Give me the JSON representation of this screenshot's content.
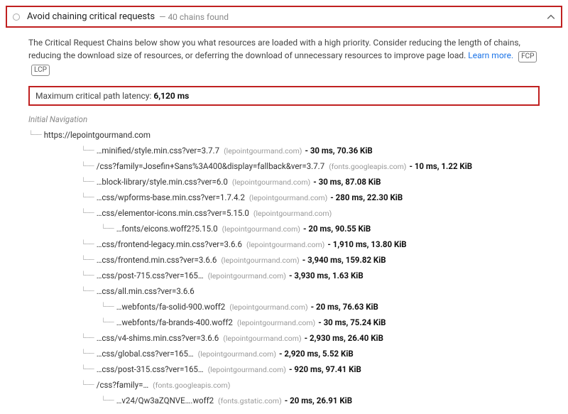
{
  "header": {
    "title": "Avoid chaining critical requests",
    "subtitle": "— 40 chains found"
  },
  "description": {
    "text1": "The Critical Request Chains below show you what resources are loaded with a high priority. Consider reducing the length of chains, reducing the download size of resources, or deferring the download of unnecessary resources to improve page load. ",
    "learn": "Learn more.",
    "badge1": "FCP",
    "badge2": "LCP"
  },
  "latency": {
    "label": "Maximum critical path latency: ",
    "value": "6,120 ms"
  },
  "tree": {
    "initial": "Initial Navigation",
    "root": "https://lepointgourmand.com",
    "rows": [
      {
        "depth": 2,
        "url": "…minified/style.min.css?ver=3.7.7",
        "origin": "(lepointgourmand.com)",
        "metrics": "- 30 ms, 70.36 KiB"
      },
      {
        "depth": 2,
        "url": "/css?family=Josefin+Sans%3A400&display=fallback&ver=3.7.7",
        "origin": "(fonts.googleapis.com)",
        "metrics": "- 10 ms, 1.22 KiB"
      },
      {
        "depth": 2,
        "url": "…block-library/style.min.css?ver=6.0",
        "origin": "(lepointgourmand.com)",
        "metrics": "- 30 ms, 87.08 KiB"
      },
      {
        "depth": 2,
        "url": "…css/wpforms-base.min.css?ver=1.7.4.2",
        "origin": "(lepointgourmand.com)",
        "metrics": "- 280 ms, 22.30 KiB"
      },
      {
        "depth": 2,
        "url": "…css/elementor-icons.min.css?ver=5.15.0",
        "origin": "(lepointgourmand.com)",
        "metrics": ""
      },
      {
        "depth": 3,
        "url": "…fonts/eicons.woff2?5.15.0",
        "origin": "(lepointgourmand.com)",
        "metrics": "- 20 ms, 90.55 KiB"
      },
      {
        "depth": 2,
        "url": "…css/frontend-legacy.min.css?ver=3.6.6",
        "origin": "(lepointgourmand.com)",
        "metrics": "- 1,910 ms, 13.80 KiB"
      },
      {
        "depth": 2,
        "url": "…css/frontend.min.css?ver=3.6.6",
        "origin": "(lepointgourmand.com)",
        "metrics": "- 3,940 ms, 159.82 KiB"
      },
      {
        "depth": 2,
        "url": "…css/post-715.css?ver=165…",
        "origin": "(lepointgourmand.com)",
        "metrics": "- 3,930 ms, 1.63 KiB"
      },
      {
        "depth": 2,
        "url": "…css/all.min.css?ver=3.6.6",
        "origin": "",
        "metrics": ""
      },
      {
        "depth": 3,
        "url": "…webfonts/fa-solid-900.woff2",
        "origin": "(lepointgourmand.com)",
        "metrics": "- 20 ms, 76.63 KiB"
      },
      {
        "depth": 3,
        "url": "…webfonts/fa-brands-400.woff2",
        "origin": "(lepointgourmand.com)",
        "metrics": "- 30 ms, 75.24 KiB"
      },
      {
        "depth": 2,
        "url": "…css/v4-shims.min.css?ver=3.6.6",
        "origin": "(lepointgourmand.com)",
        "metrics": "- 2,930 ms, 26.40 KiB"
      },
      {
        "depth": 2,
        "url": "…css/global.css?ver=165…",
        "origin": "(lepointgourmand.com)",
        "metrics": "- 2,920 ms, 5.52 KiB"
      },
      {
        "depth": 2,
        "url": "…css/post-315.css?ver=165…",
        "origin": "(lepointgourmand.com)",
        "metrics": "- 920 ms, 97.41 KiB"
      },
      {
        "depth": 2,
        "url": "/css?family=…",
        "origin": "(fonts.googleapis.com)",
        "metrics": ""
      },
      {
        "depth": 3,
        "url": "…v24/Qw3aZQNVE….woff2",
        "origin": "(fonts.gstatic.com)",
        "metrics": "- 20 ms, 26.91 KiB"
      }
    ]
  }
}
